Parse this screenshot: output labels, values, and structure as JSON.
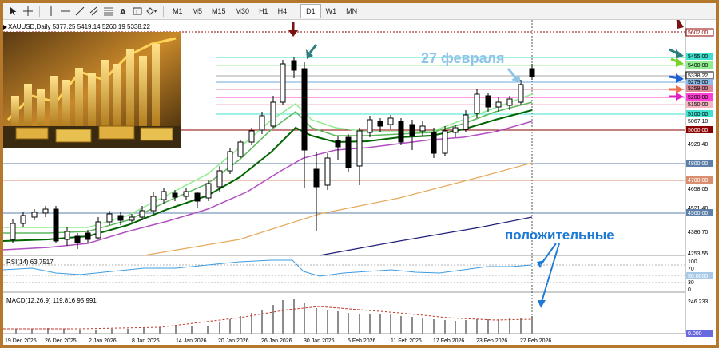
{
  "toolbar": {
    "tools": [
      "cursor-tool-icon",
      "crosshair-tool-icon",
      "vertical-line-tool-icon",
      "horizontal-line-tool-icon",
      "trendline-tool-icon",
      "channel-tool-icon",
      "fibonacci-tool-icon",
      "text-tool-icon",
      "label-tool-icon",
      "shapes-tool-icon"
    ],
    "timeframes": [
      "M1",
      "M5",
      "M15",
      "M30",
      "H1",
      "H4",
      "D1",
      "W1",
      "MN"
    ],
    "active_timeframe": "D1"
  },
  "chart": {
    "symbol_info": "XAUUSD,Daily  5377.25 5419.14 5260.19 5338.22",
    "annotation_date": "27 февраля",
    "annotation_positive": "положительные",
    "price_labels": [
      "5602.00",
      "5455.00",
      "5400.00",
      "5338.22",
      "5279.00",
      "5259.00",
      "5200.00",
      "5150.00",
      "5100.00",
      "5067.10",
      "5000.00",
      "4929.40",
      "4800.00",
      "4700.00",
      "4658.05",
      "4521.40",
      "4500.00",
      "4386.70",
      "4253.55"
    ],
    "date_labels": [
      "19 Dec 2025",
      "26 Dec 2025",
      "2 Jan 2026",
      "8 Jan 2026",
      "14 Jan 2026",
      "20 Jan 2026",
      "26 Jan 2026",
      "30 Jan 2026",
      "5 Feb 2026",
      "11 Feb 2026",
      "17 Feb 2026",
      "23 Feb 2026",
      "27 Feb 2026"
    ],
    "colors": {
      "bull": "#ffffff",
      "bear": "#000000",
      "ma_fast": "#90ee90",
      "ma_mid": "#5cb85c",
      "ma_slow": "#006400",
      "ma_purple": "#b04fc0",
      "ma_orange": "#e6a85c",
      "ma_navy": "#1f1f7a",
      "resistance": "#8b0000",
      "support": "#a0522d",
      "fib_cyan": "#40e0d0"
    }
  },
  "rsi": {
    "label": "RSI(14) 63.7517",
    "levels": [
      "100",
      "70",
      "50.0000",
      "30",
      "0"
    ]
  },
  "macd": {
    "label": "MACD(12,26,9) 119.816 95.991",
    "levels": [
      "246.233",
      "0.000"
    ]
  }
}
